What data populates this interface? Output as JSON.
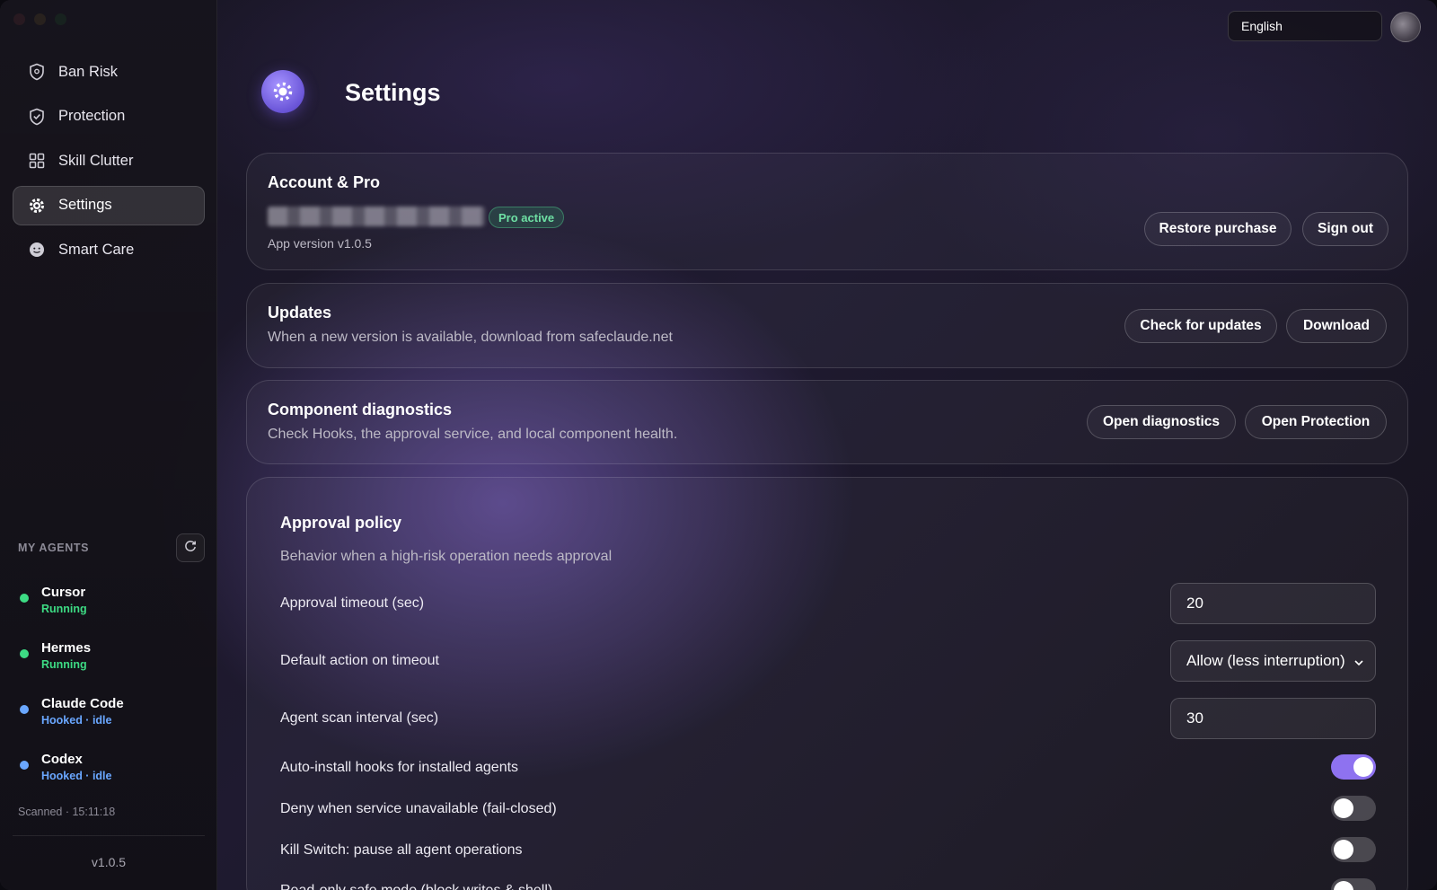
{
  "window": {
    "title": "Settings"
  },
  "sidebar": {
    "nav": [
      {
        "label": "Ban Risk",
        "icon": "shield-icon"
      },
      {
        "label": "Protection",
        "icon": "shield-check-icon"
      },
      {
        "label": "Skill Clutter",
        "icon": "grid-icon"
      },
      {
        "label": "Settings",
        "icon": "gear-icon",
        "active": true
      },
      {
        "label": "Smart Care",
        "icon": "smiley-icon"
      }
    ],
    "agents_title": "MY AGENTS",
    "agents": [
      {
        "name": "Cursor",
        "status": "Running",
        "color": "#3ddc84"
      },
      {
        "name": "Hermes",
        "status": "Running",
        "color": "#3ddc84"
      },
      {
        "name": "Claude Code",
        "status": "Hooked · idle",
        "color": "#6aa7ff"
      },
      {
        "name": "Codex",
        "status": "Hooked · idle",
        "color": "#6aa7ff"
      }
    ],
    "scanned": "Scanned · 15:11:18",
    "version": "v1.0.5"
  },
  "topbar": {
    "language": "English"
  },
  "header": {
    "title": "Settings"
  },
  "account": {
    "title": "Account & Pro",
    "badge": "Pro active",
    "app_version": "App version  v1.0.5",
    "restore_label": "Restore purchase",
    "signout_label": "Sign out"
  },
  "updates": {
    "title": "Updates",
    "subtitle": "When a new version is available, download from safeclaude.net",
    "check_label": "Check for updates",
    "download_label": "Download"
  },
  "diagnostics": {
    "title": "Component diagnostics",
    "subtitle": "Check Hooks, the approval service, and local component health.",
    "open_diag_label": "Open diagnostics",
    "open_protection_label": "Open Protection"
  },
  "approval": {
    "title": "Approval policy",
    "subtitle": "Behavior when a high-risk operation needs approval",
    "timeout_label": "Approval timeout (sec)",
    "timeout_value": "20",
    "default_action_label": "Default action on timeout",
    "default_action_value": "Allow (less interruption)",
    "scan_interval_label": "Agent scan interval (sec)",
    "scan_interval_value": "30",
    "toggles": [
      {
        "label": "Auto-install hooks for installed agents",
        "on": true
      },
      {
        "label": "Deny when service unavailable (fail-closed)",
        "on": false
      },
      {
        "label": "Kill Switch: pause all agent operations",
        "on": false
      },
      {
        "label": "Read-only safe mode (block writes & shell)",
        "on": false
      }
    ]
  },
  "colors": {
    "accent": "#8e72f0",
    "running": "#3ddc84",
    "hooked": "#6aa7ff",
    "pro_badge": "#6ee0a4"
  }
}
